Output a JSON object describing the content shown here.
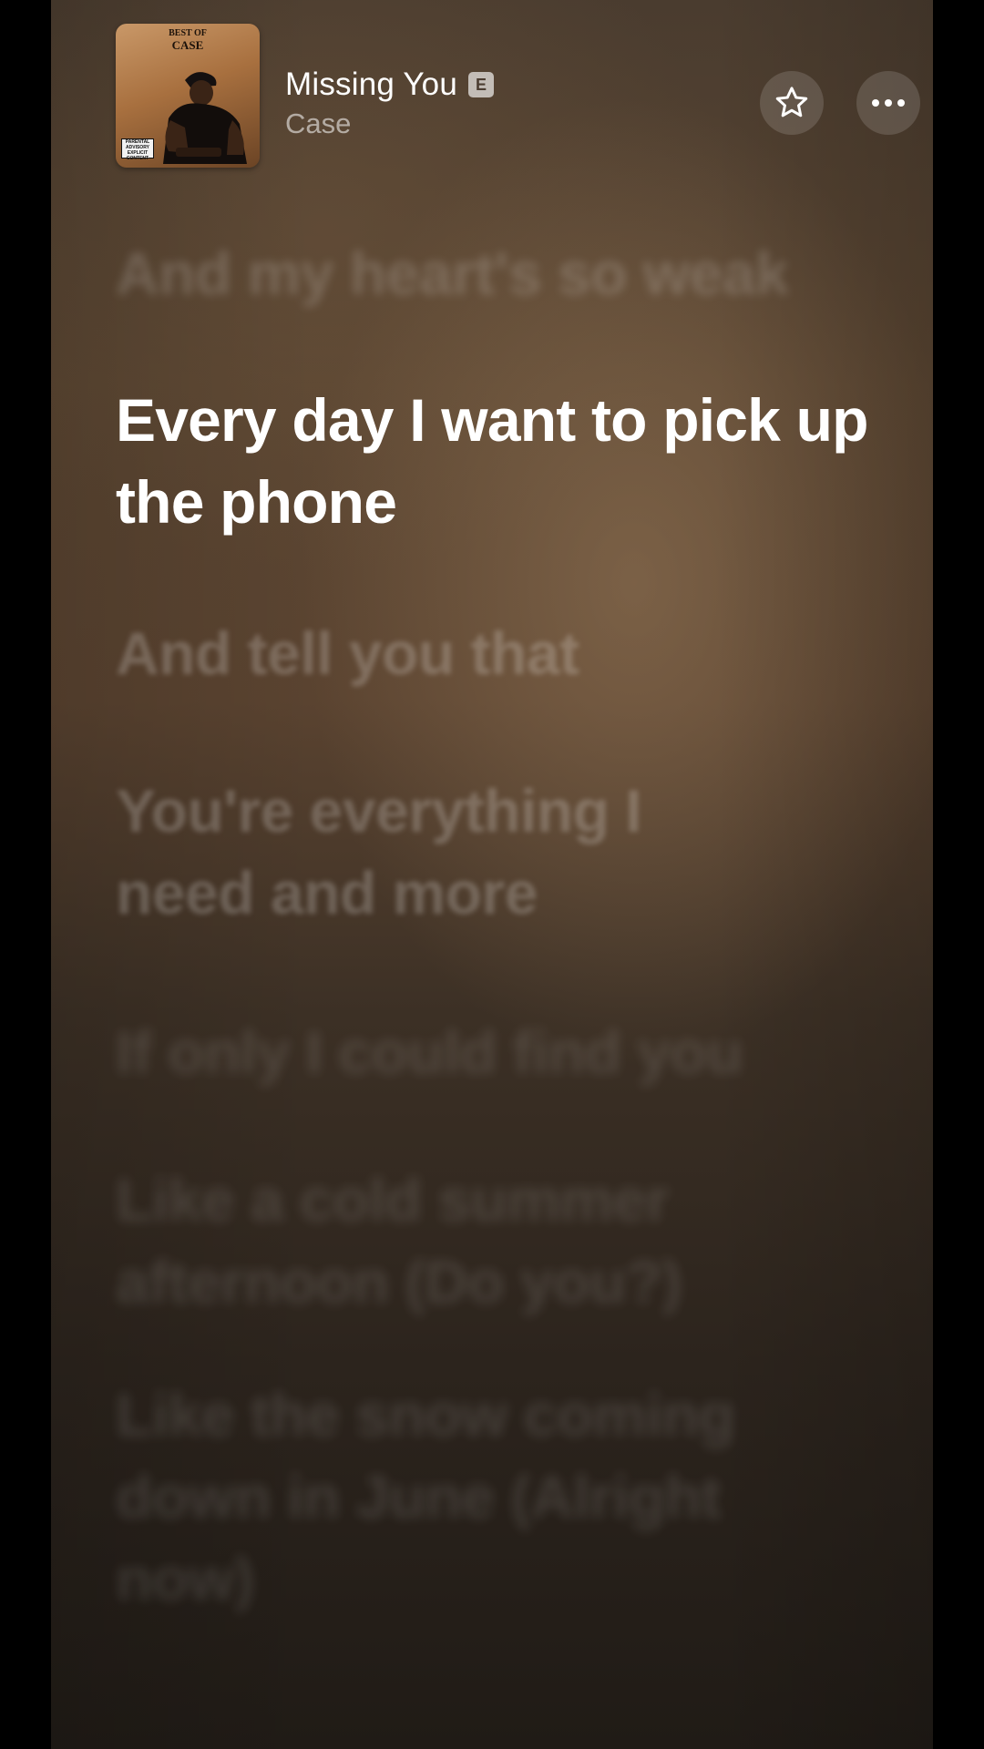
{
  "now_playing": {
    "title": "Missing You",
    "explicit_badge": "E",
    "artist": "Case",
    "artwork": {
      "line1": "BEST OF",
      "line2": "CASE",
      "advisory_text": "PARENTAL ADVISORY EXPLICIT CONTENT"
    }
  },
  "actions": {
    "favorite_icon": "star-outline-icon",
    "more_icon": "ellipsis-icon"
  },
  "lyrics": {
    "previous_line": "And my heart's so weak",
    "current_line": "Every day I want to pick up the phone",
    "upcoming": [
      "And tell you that",
      "You're everything I need and more",
      "If only I could find you",
      "Like a cold summer afternoon (Do you?)",
      "Like the snow coming down in June (Alright now)"
    ]
  },
  "colors": {
    "text_primary": "#ffffff",
    "background_top": "#4a3c2f",
    "background_bottom": "#201b16"
  }
}
